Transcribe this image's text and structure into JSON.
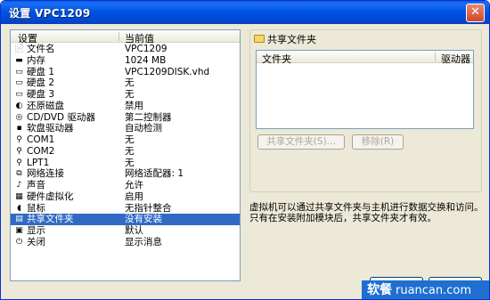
{
  "window": {
    "title": "设置 VPC1209",
    "close_glyph": "✕"
  },
  "settings": {
    "header_setting": "设置",
    "header_value": "当前值",
    "rows": [
      {
        "name": "文件名",
        "value": "VPC1209",
        "icon": "file-icon"
      },
      {
        "name": "内存",
        "value": "1024 MB",
        "icon": "memory-icon"
      },
      {
        "name": "硬盘 1",
        "value": "VPC1209DISK.vhd",
        "icon": "harddisk-icon"
      },
      {
        "name": "硬盘 2",
        "value": "无",
        "icon": "harddisk-icon"
      },
      {
        "name": "硬盘 3",
        "value": "无",
        "icon": "harddisk-icon"
      },
      {
        "name": "还原磁盘",
        "value": "禁用",
        "icon": "undo-disk-icon"
      },
      {
        "name": "CD/DVD 驱动器",
        "value": "第二控制器",
        "icon": "cd-icon"
      },
      {
        "name": "软盘驱动器",
        "value": "自动检测",
        "icon": "floppy-icon"
      },
      {
        "name": "COM1",
        "value": "无",
        "icon": "port-icon"
      },
      {
        "name": "COM2",
        "value": "无",
        "icon": "port-icon"
      },
      {
        "name": "LPT1",
        "value": "无",
        "icon": "port-icon"
      },
      {
        "name": "网络连接",
        "value": "网络适配器: 1",
        "icon": "network-icon"
      },
      {
        "name": "声音",
        "value": "允许",
        "icon": "sound-icon"
      },
      {
        "name": "硬件虚拟化",
        "value": "启用",
        "icon": "hardware-icon"
      },
      {
        "name": "鼠标",
        "value": "无指针整合",
        "icon": "mouse-icon"
      },
      {
        "name": "共享文件夹",
        "value": "没有安装",
        "icon": "shared-folder-icon",
        "selected": true
      },
      {
        "name": "显示",
        "value": "默认",
        "icon": "display-icon"
      },
      {
        "name": "关闭",
        "value": "显示消息",
        "icon": "close-setting-icon"
      }
    ]
  },
  "shared_folders": {
    "group_title": "共享文件夹",
    "col_folder": "文件夹",
    "col_drive": "驱动器",
    "share_button": "共享文件夹(S)...",
    "remove_button": "移除(R)",
    "info_text": "虚拟机可以通过共享文件夹与主机进行数据交换和访问。只有在安装附加模块后，共享文件夹才有效。"
  },
  "watermark": {
    "cn": "软餐",
    "en": "ruancan.com"
  }
}
